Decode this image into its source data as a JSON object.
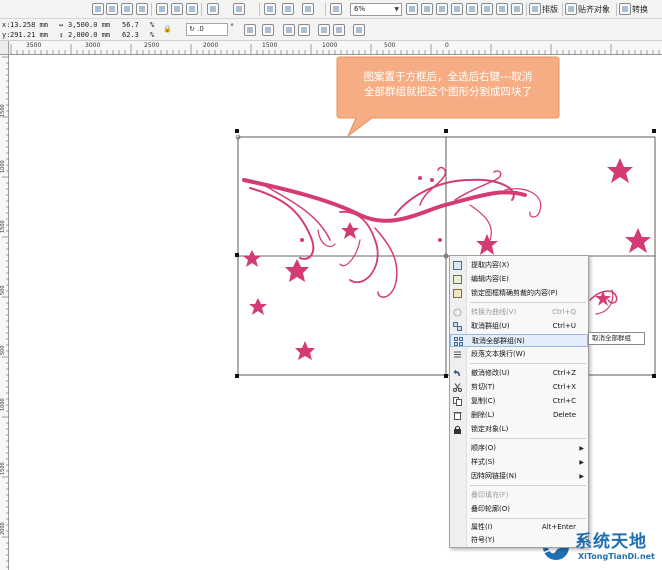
{
  "toolbar": {
    "zoom_value": "6%",
    "layout_label": "排版",
    "snap_label": "贴齐对象",
    "transform_label": "转换",
    "icons": [
      "new-icon",
      "open-icon",
      "save-icon",
      "print-icon",
      "cut-icon",
      "copy-icon",
      "paste-icon",
      "undo-icon",
      "redo-icon",
      "import-icon",
      "export-icon",
      "publish-icon",
      "zoom-in-icon",
      "zoom-out-icon",
      "zoom-fit-icon",
      "zoom-page-icon",
      "zoom-width-icon",
      "zoom-height-icon",
      "zoom-selected-icon",
      "pan-icon"
    ]
  },
  "property_bar": {
    "x_label": "x:",
    "x_value": "13.258 mm",
    "y_label": "y:",
    "y_value": "291.21 mm",
    "width_value": "3,500.0 mm",
    "height_value": "2,000.0 mm",
    "scale_w": "56.7",
    "scale_h": "62.3",
    "percent": "%",
    "rotation_value": ".0",
    "degree": "°"
  },
  "ruler": {
    "top_labels": [
      "3500",
      "3000",
      "2500",
      "2000",
      "1500",
      "1000",
      "500",
      "0"
    ],
    "left_labels": [
      "1500",
      "1000",
      "1500",
      "1000",
      "500",
      "0",
      "500",
      "1000",
      "1500",
      "2000"
    ]
  },
  "callout": {
    "line1": "图案置于方框后，全选后右键---取消",
    "line2": "全部群组就把这个图形分割成四块了"
  },
  "context_menu": {
    "items": [
      {
        "label": "提取内容(X)",
        "shortcut": "",
        "icon": "extract-content-icon",
        "disabled": false
      },
      {
        "label": "编辑内容(E)",
        "shortcut": "",
        "icon": "edit-content-icon",
        "disabled": false
      },
      {
        "label": "锁定图框精确剪裁的内容(P)",
        "shortcut": "",
        "icon": "lock-contents-icon",
        "disabled": false
      },
      {
        "label": "转换为曲线(V)",
        "shortcut": "Ctrl+Q",
        "icon": "convert-curves-icon",
        "disabled": true
      },
      {
        "label": "取消群组(U)",
        "shortcut": "Ctrl+U",
        "icon": "ungroup-icon",
        "disabled": false
      },
      {
        "label": "取消全部群组(N)",
        "shortcut": "",
        "icon": "ungroup-all-icon",
        "disabled": false
      },
      {
        "label": "段落文本换行(W)",
        "shortcut": "",
        "icon": "text-wrap-icon",
        "disabled": false
      },
      {
        "label": "撤消修改(U)",
        "shortcut": "Ctrl+Z",
        "icon": "undo-icon",
        "disabled": false
      },
      {
        "label": "剪切(T)",
        "shortcut": "Ctrl+X",
        "icon": "cut-icon",
        "disabled": false
      },
      {
        "label": "复制(C)",
        "shortcut": "Ctrl+C",
        "icon": "copy-icon",
        "disabled": false
      },
      {
        "label": "删除(L)",
        "shortcut": "Delete",
        "icon": "delete-icon",
        "disabled": false
      },
      {
        "label": "锁定对象(L)",
        "shortcut": "",
        "icon": "lock-icon",
        "disabled": false
      },
      {
        "label": "顺序(O)",
        "shortcut": "",
        "icon": "",
        "disabled": false,
        "submenu": true
      },
      {
        "label": "样式(S)",
        "shortcut": "",
        "icon": "",
        "disabled": false,
        "submenu": true
      },
      {
        "label": "因特网链接(N)",
        "shortcut": "",
        "icon": "",
        "disabled": false,
        "submenu": true
      },
      {
        "label": "叠印填充(F)",
        "shortcut": "",
        "icon": "",
        "disabled": true
      },
      {
        "label": "叠印轮廓(O)",
        "shortcut": "",
        "icon": "",
        "disabled": false
      },
      {
        "label": "属性(I)",
        "shortcut": "Alt+Enter",
        "icon": "",
        "disabled": false
      },
      {
        "label": "符号(Y)",
        "shortcut": "",
        "icon": "",
        "disabled": false,
        "submenu": true
      }
    ],
    "highlighted_index": 5,
    "tooltip": "取消全部群组"
  },
  "watermark": {
    "title": "系统天地",
    "subtitle": "XiTongTianDi.net"
  },
  "colors": {
    "flower": "#d43a73",
    "callout_fill": "#f6ad83",
    "callout_border": "#e6905e",
    "menu_highlight": "#e4eefb",
    "watermark": "#1f6fb2"
  }
}
